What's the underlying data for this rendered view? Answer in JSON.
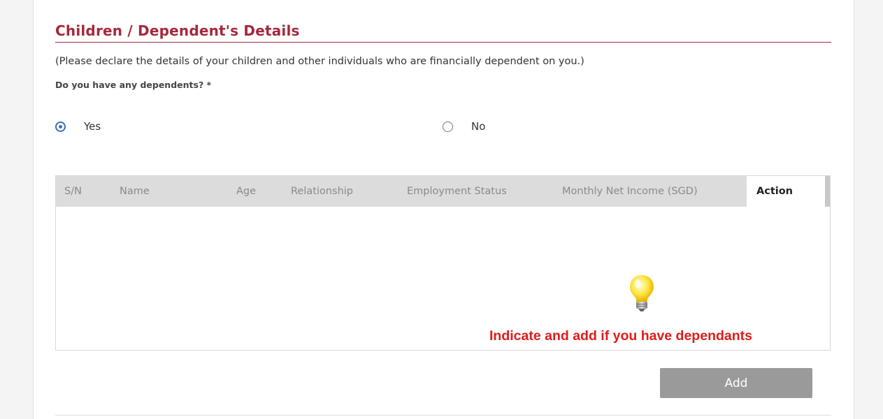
{
  "section": {
    "title": "Children / Dependent's Details",
    "intro": "(Please declare the details of your children and other individuals who are financially dependent on you.)",
    "question": "Do you have any dependents? *"
  },
  "radio": {
    "yes_label": "Yes",
    "no_label": "No",
    "selected": "Yes"
  },
  "table": {
    "columns": [
      "S/N",
      "Name",
      "Age",
      "Relationship",
      "Employment Status",
      "Monthly Net Income (SGD)",
      "Action"
    ],
    "rows": []
  },
  "hint": {
    "icon": "lightbulb-icon",
    "text": "Indicate and add if you have dependants"
  },
  "buttons": {
    "add_label": "Add"
  },
  "colors": {
    "accent": "#a6283c",
    "radio_selected": "#3a6fb5",
    "hint_text": "#e01b1b",
    "button_bg": "#9a9a9a",
    "header_bg": "#dcdcdc"
  }
}
